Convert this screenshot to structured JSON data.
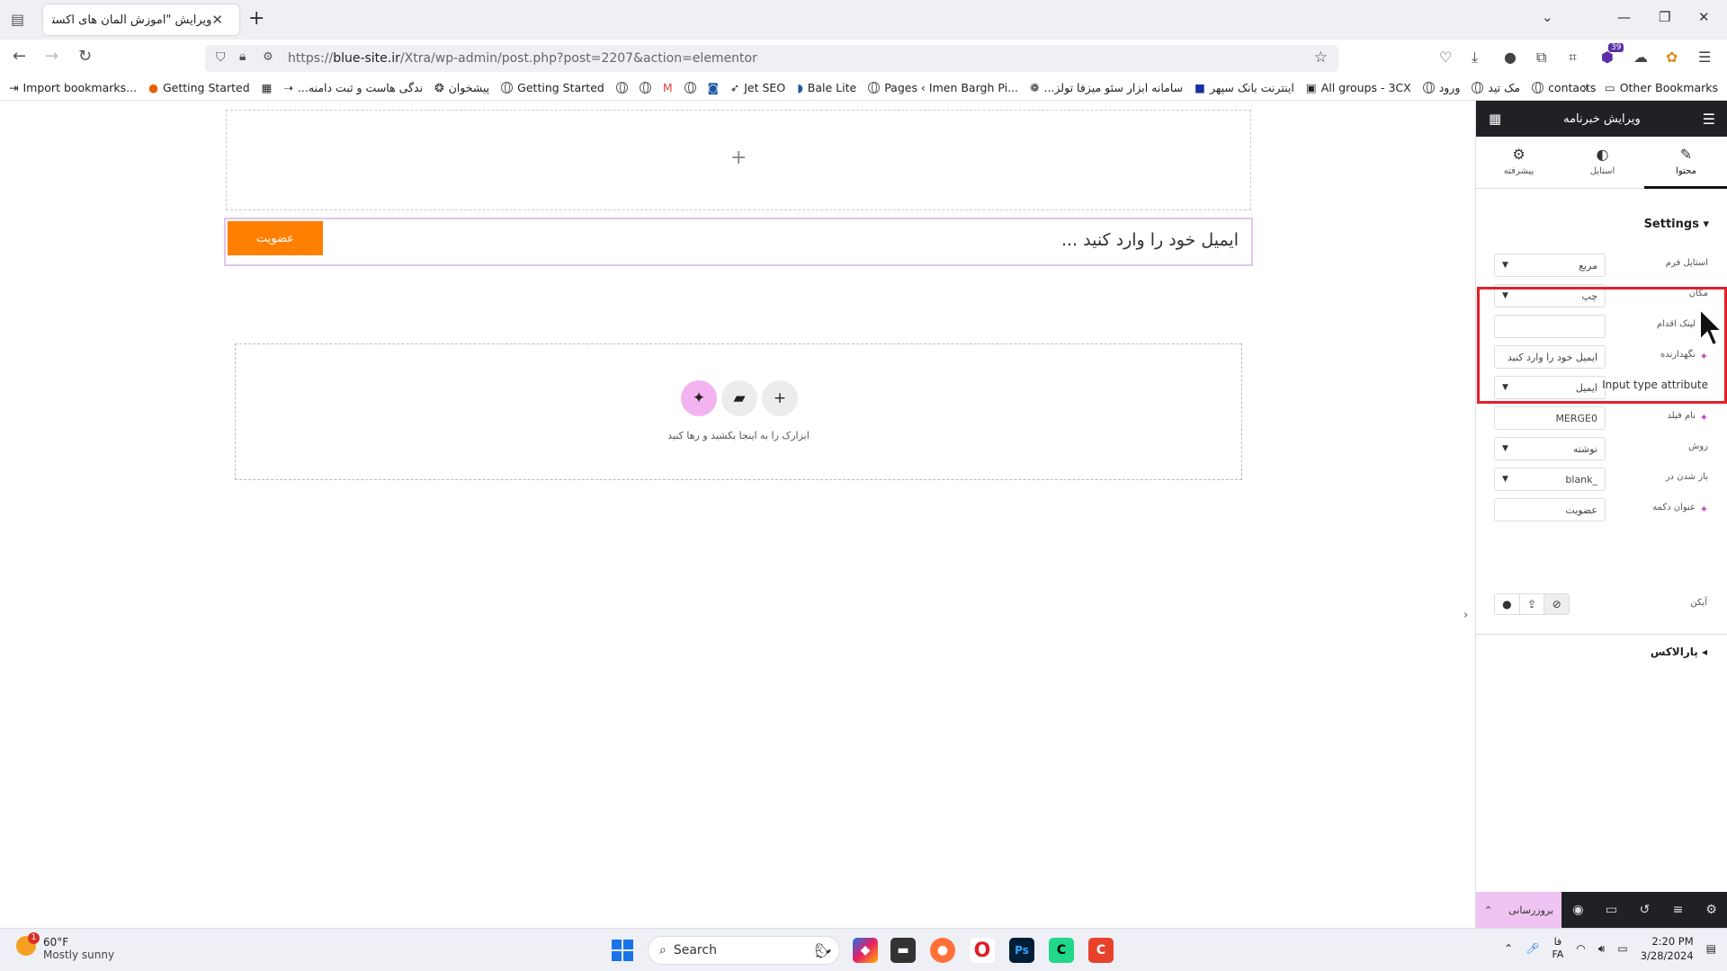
{
  "browser": {
    "tab_title": "ویرایش \"آموزش المان های اکسترا ...",
    "url_prefix": "https://",
    "url_domain": "blue-site.ir",
    "url_path": "/Xtra/wp-admin/post.php?post=2207&action=elementor",
    "extension_badge": "39",
    "bookmarks": [
      "Import bookmarks...",
      "Getting Started",
      "...ندگی هاست و ثبت دامنه",
      "پیشخوان",
      "Getting Started",
      "Jet SEO",
      "Bale Lite",
      "Pages ‹ Imen Bargh Pi...",
      "...سامانه ابزار سئو میزفا تولز",
      "اینترنت بانک سپهر",
      "All groups - 3CX",
      "ورود",
      "مک تید",
      "contacts"
    ],
    "other_bookmarks": "Other Bookmarks"
  },
  "canvas": {
    "subscribe_button": "عضویت",
    "email_placeholder": "ایمیل خود را وارد کنید ...",
    "drop_hint": "ابزارک را به اینجا بکشید و رها کنید"
  },
  "panel": {
    "title": "ویرایش خبرنامه",
    "tabs": [
      "محتوا",
      "استایل",
      "پیشرفته"
    ],
    "section_settings": "Settings",
    "fields": [
      {
        "label": "استایل فرم",
        "value": "مربع",
        "type": "select"
      },
      {
        "label": "مکان",
        "value": "چپ",
        "type": "select"
      },
      {
        "label": "لینک اقدام",
        "value": "",
        "type": "text"
      },
      {
        "label": "نگهدارنده",
        "value": "ایمیل خود را وارد کنید",
        "type": "text"
      },
      {
        "label": "Input type attribute",
        "value": "ایمیل",
        "type": "select"
      },
      {
        "label": "نام فیلد",
        "value": "MERGE0",
        "type": "text"
      },
      {
        "label": "روش",
        "value": "نوشته",
        "type": "select"
      },
      {
        "label": "باز شدن در",
        "value": "_blank",
        "type": "select"
      },
      {
        "label": "عنوان دکمه",
        "value": "عضویت",
        "type": "text"
      }
    ],
    "icon_label": "آیکن",
    "section_parallax": "پارالاکس",
    "update_button": "بروزرسانی"
  },
  "taskbar": {
    "temperature": "60°F",
    "weather": "Mostly sunny",
    "weather_badge": "1",
    "search_placeholder": "Search",
    "lang_top": "فا",
    "lang_bottom": "FA",
    "time": "2:20 PM",
    "date": "3/28/2024"
  },
  "colors": {
    "accent": "#ff7f00",
    "panel_dark": "#1f2124",
    "highlight": "#e3202a",
    "update_pink": "#f0c4f2"
  }
}
